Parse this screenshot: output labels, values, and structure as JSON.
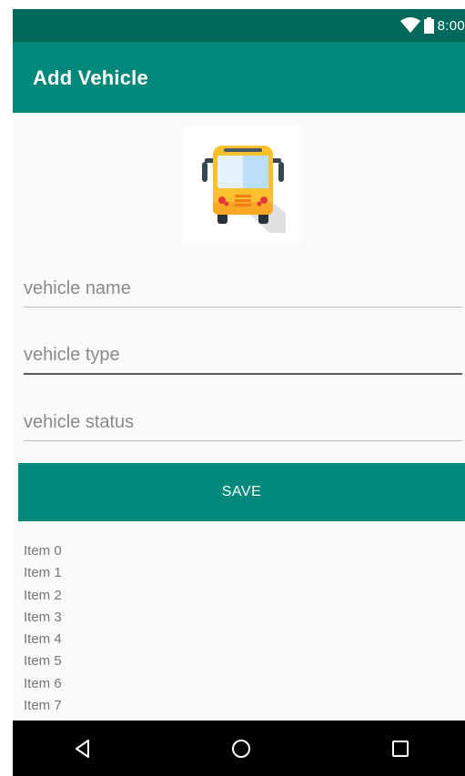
{
  "status_bar": {
    "time": "8:00",
    "icons": [
      "wifi-icon",
      "battery-icon"
    ],
    "color": "#00695c"
  },
  "app_bar": {
    "title": "Add Vehicle",
    "color": "#00897b"
  },
  "vehicle_image": {
    "icon": "bus-icon"
  },
  "form": {
    "name_placeholder": "vehicle name",
    "name_value": "",
    "type_placeholder": "vehicle type",
    "type_value": "",
    "status_placeholder": "vehicle status",
    "status_value": "",
    "focused_field": "vehicle type"
  },
  "save_button": {
    "label": "SAVE",
    "color": "#00897b"
  },
  "items": [
    "Item 0",
    "Item 1",
    "Item 2",
    "Item 3",
    "Item 4",
    "Item 5",
    "Item 6",
    "Item 7"
  ],
  "nav_bar": {
    "icons": [
      "back-icon",
      "home-icon",
      "recents-icon"
    ]
  }
}
